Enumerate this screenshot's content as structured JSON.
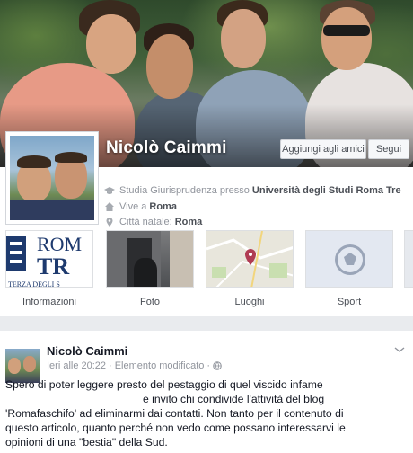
{
  "profile": {
    "name": "Nicolò Caimmi",
    "add_friend_label": "Aggiungi agli amici",
    "follow_label": "Segui"
  },
  "info": {
    "study_prefix": "Studia Giurisprudenza presso",
    "study_place": "Università degli Studi Roma Tre",
    "lives_prefix": "Vive a",
    "lives_place": "Roma",
    "hometown_prefix": "Città natale:",
    "hometown_place": "Roma"
  },
  "tiles": [
    {
      "label": "Informazioni"
    },
    {
      "label": "Foto"
    },
    {
      "label": "Luoghi"
    },
    {
      "label": "Sport"
    }
  ],
  "tile_info_logo": {
    "line1": "ROM",
    "line2": "TR",
    "line3": "TERZA DEGLI S"
  },
  "post": {
    "author": "Nicolò Caimmi",
    "time": "Ieri alle 20:22",
    "edited": "Elemento modificato",
    "line1": "Spero di poter leggere presto del pestaggio di quel viscido infame",
    "line2": "e invito chi condivide l'attività del blog",
    "line3": "'Romafaschifo' ad eliminarmi dai contatti. Non tanto per il contenuto di",
    "line4": "questo articolo, quanto perché non vedo come possano interessarvi le",
    "line5": "opinioni di una \"bestia\" della Sud."
  },
  "icons": {
    "study": "graduation-cap-icon",
    "home": "house-icon",
    "location": "pin-icon",
    "privacy": "globe-icon",
    "menu": "chevron-down-icon"
  },
  "colors": {
    "text": "#141823",
    "muted": "#90949c",
    "link_bold": "#4b4f56",
    "divider": "#e9ebee"
  }
}
